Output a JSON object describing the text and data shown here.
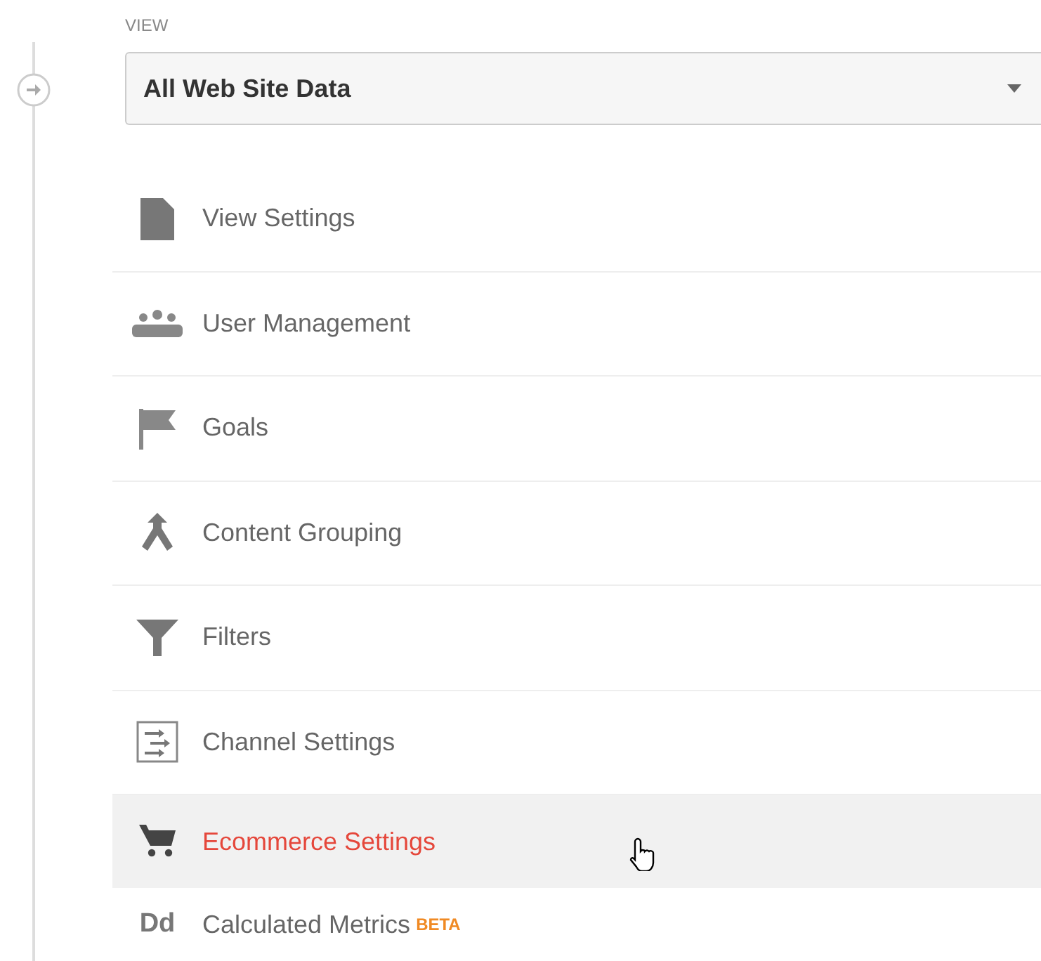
{
  "view_label": "VIEW",
  "view_select": {
    "value": "All Web Site Data"
  },
  "items": [
    {
      "label": "View Settings",
      "kind": "document",
      "hovered": false
    },
    {
      "label": "User Management",
      "kind": "people",
      "hovered": false
    },
    {
      "label": "Goals",
      "kind": "flag",
      "hovered": false
    },
    {
      "label": "Content Grouping",
      "kind": "merge",
      "hovered": false
    },
    {
      "label": "Filters",
      "kind": "funnel",
      "hovered": false
    },
    {
      "label": "Channel Settings",
      "kind": "channels",
      "hovered": false
    },
    {
      "label": "Ecommerce Settings",
      "kind": "cart",
      "hovered": true
    },
    {
      "label": "Calculated Metrics",
      "kind": "text",
      "icon_text": "Dd",
      "badge": "BETA",
      "hovered": false
    }
  ]
}
